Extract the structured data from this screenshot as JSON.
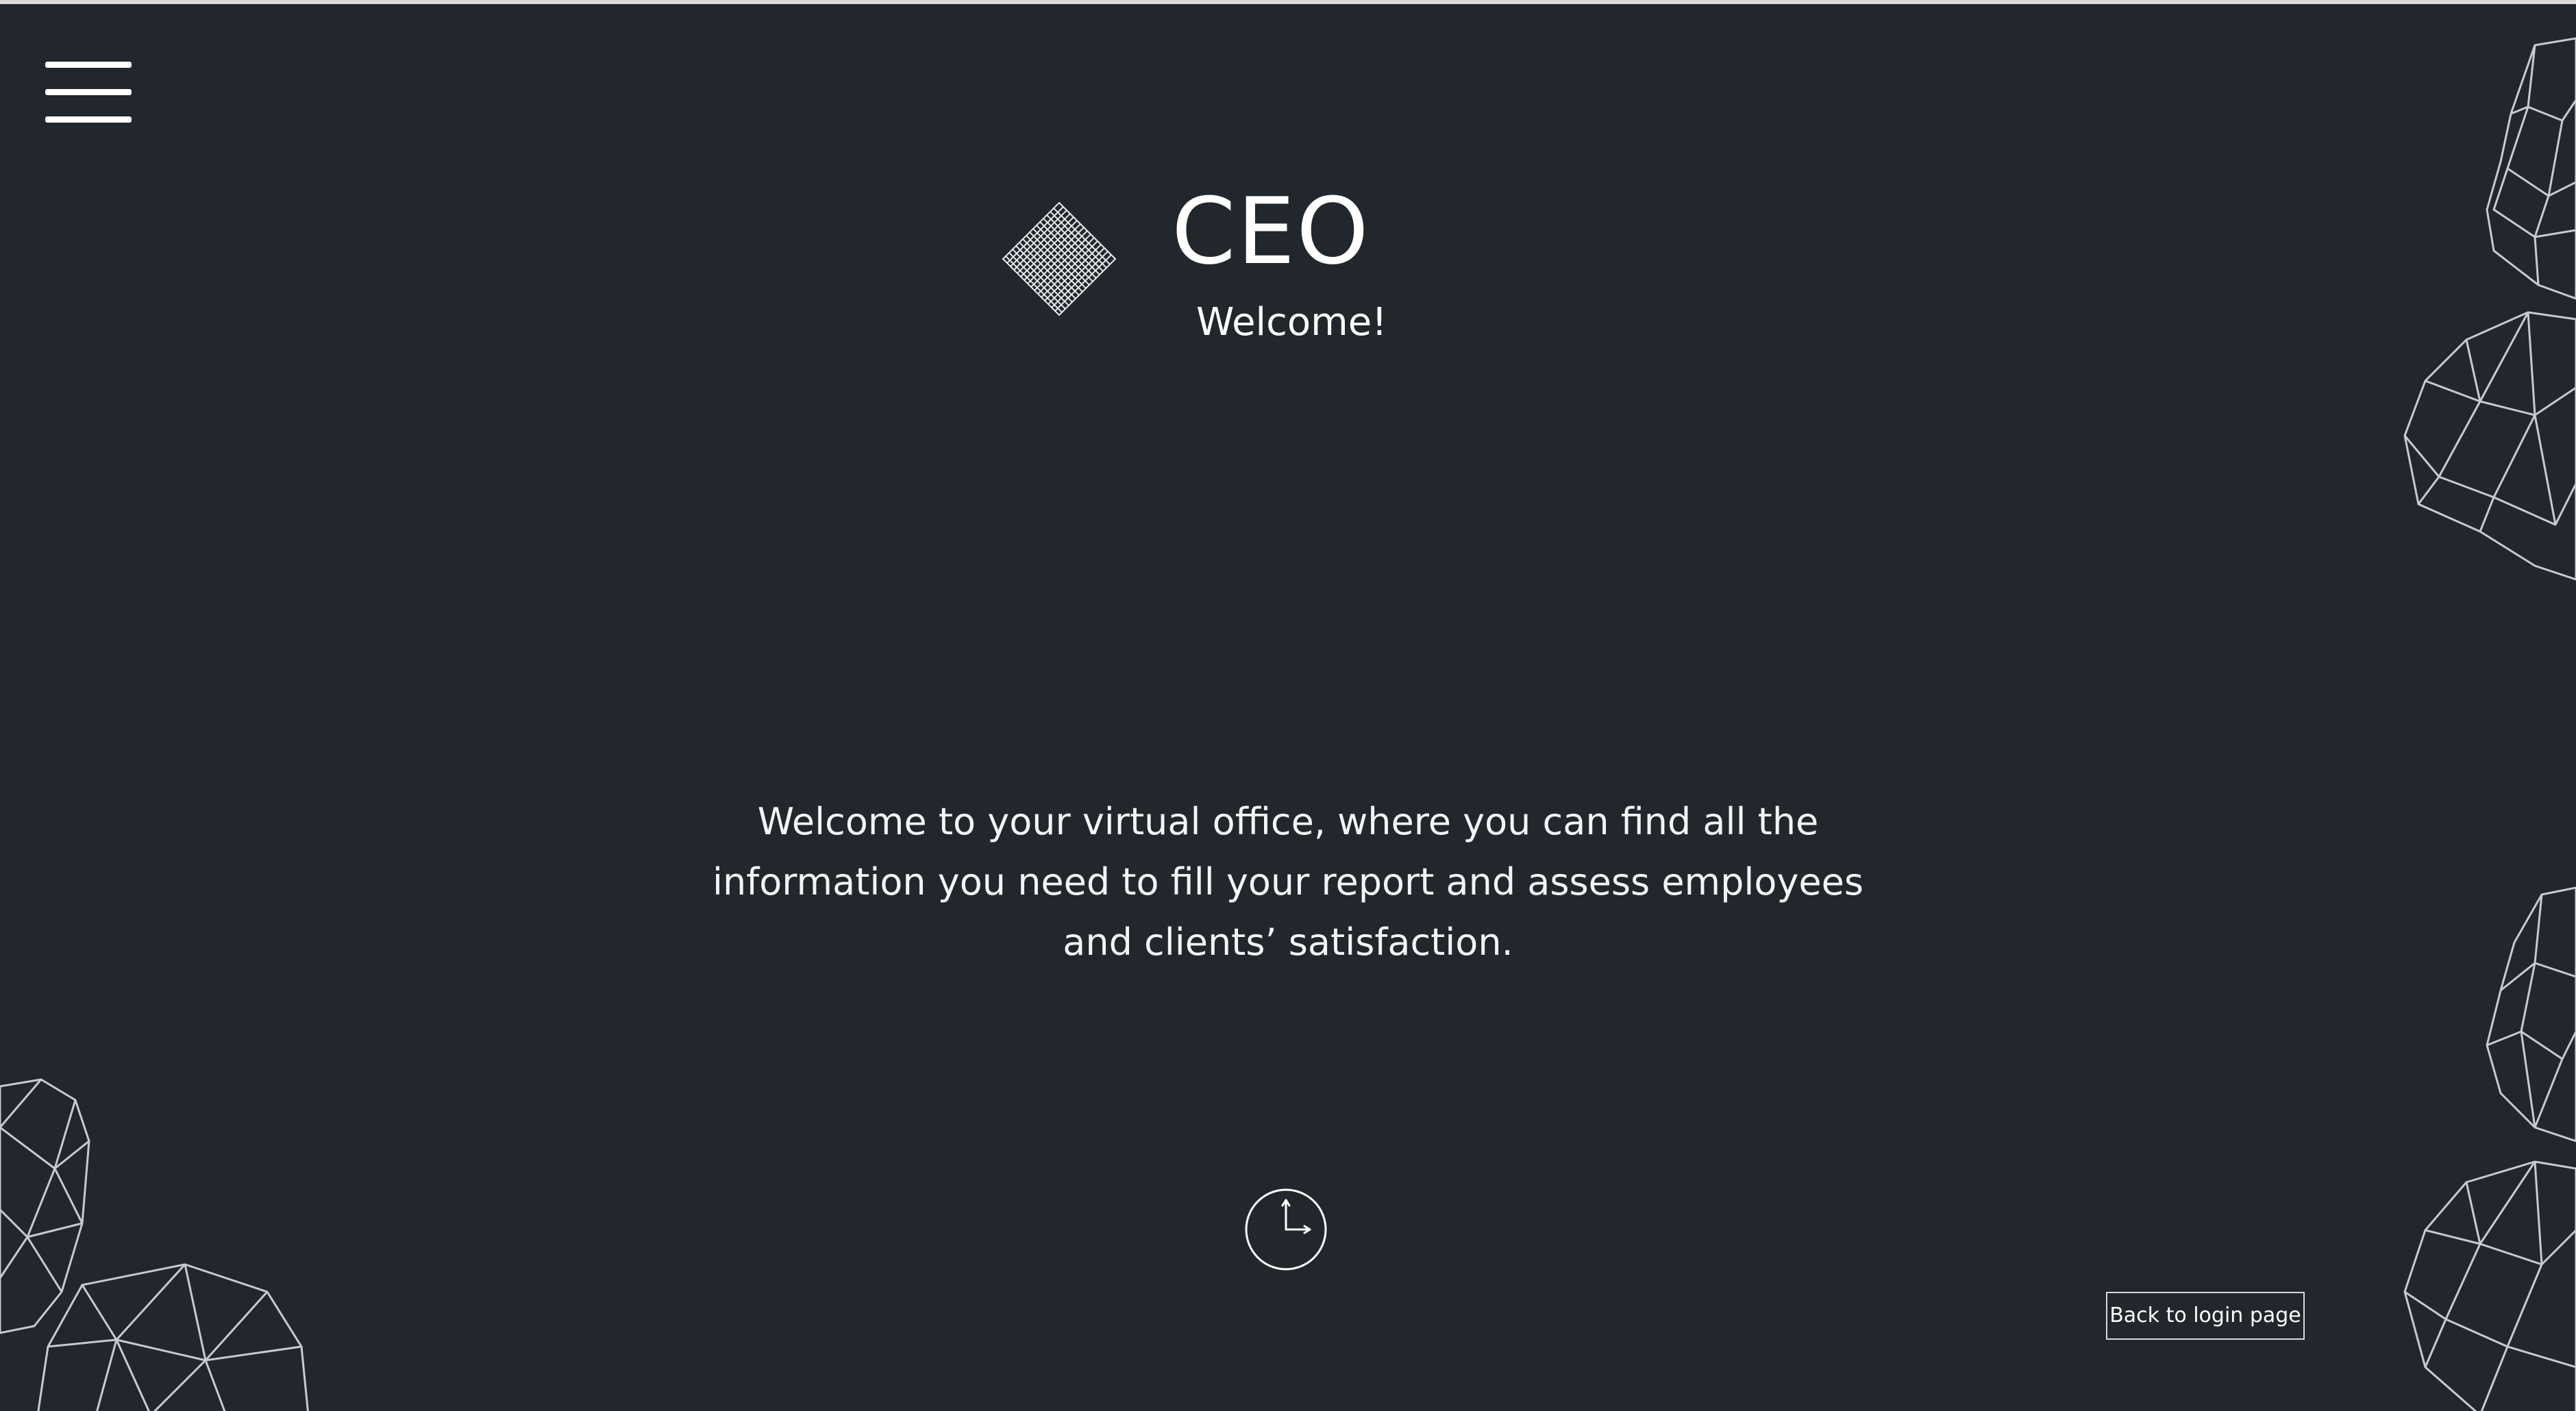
{
  "header": {
    "menu_icon": "hamburger-menu-icon",
    "logo_icon": "diamond-logo-icon",
    "title": "CEO",
    "subtitle": "Welcome!"
  },
  "main": {
    "welcome_message": "Welcome to your virtual office, where you can find all the information you need to fill your report and assess employees and clients’ satisfaction.",
    "clock_icon": "clock-icon"
  },
  "footer": {
    "back_button_label": "Back to login page"
  },
  "colors": {
    "background": "#21272c",
    "text": "#ffffff",
    "line_art": "#d8dde2"
  }
}
